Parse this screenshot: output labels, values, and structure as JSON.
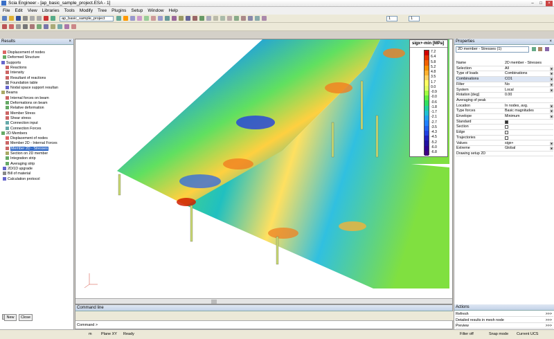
{
  "window": {
    "title": "Scia Engineer - [ap_basic_sample_project.ESA - 1]"
  },
  "menu": [
    "File",
    "Edit",
    "View",
    "Libraries",
    "Tools",
    "Modify",
    "Tree",
    "Plugins",
    "Setup",
    "Window",
    "Help"
  ],
  "toolbar": {
    "project_combo": "ap_basic_sample_project",
    "spin1": "1",
    "spin2": "1"
  },
  "results_panel": {
    "title": "Results",
    "items": [
      {
        "label": "Displacement of nodes",
        "icon": "node-icon"
      },
      {
        "label": "Deformed Structure",
        "icon": "deform-icon"
      },
      {
        "label": "Supports",
        "icon": "support-icon"
      },
      {
        "label": "Reactions",
        "icon": "reaction-icon"
      },
      {
        "label": "Intensity",
        "icon": "intensity-icon"
      },
      {
        "label": "Resultant of reactions",
        "icon": "resultant-icon"
      },
      {
        "label": "Foundation table",
        "icon": "table-icon"
      },
      {
        "label": "Nodal space support resultan",
        "icon": "support-icon"
      },
      {
        "label": "Beams",
        "icon": "beam-icon"
      },
      {
        "label": "Internal forces on beam",
        "icon": "force-icon"
      },
      {
        "label": "Deformations on beam",
        "icon": "deform-icon"
      },
      {
        "label": "Relative deformation",
        "icon": "deform-icon"
      },
      {
        "label": "Member Stress",
        "icon": "stress-icon"
      },
      {
        "label": "Shear stress",
        "icon": "stress-icon"
      },
      {
        "label": "Connection input",
        "icon": "connection-icon"
      },
      {
        "label": "Connection Forces",
        "icon": "connection-icon"
      },
      {
        "label": "2D Members",
        "icon": "member-icon"
      },
      {
        "label": "Displacement of nodes",
        "icon": "node-icon"
      },
      {
        "label": "Member 2D - Internal Forces",
        "icon": "force-icon"
      },
      {
        "label": "Member 2D - Stresses",
        "icon": "stress-icon"
      },
      {
        "label": "Section on 2D member",
        "icon": "section-icon"
      },
      {
        "label": "Integration strip",
        "icon": "strip-icon"
      },
      {
        "label": "Averaging strip",
        "icon": "strip-icon"
      },
      {
        "label": "2D/1D upgrade",
        "icon": "upgrade-icon"
      },
      {
        "label": "Bill of material",
        "icon": "table-icon"
      },
      {
        "label": "Calculation protocol",
        "icon": "protocol-icon"
      }
    ],
    "buttons": {
      "new": "New",
      "close": "Close"
    }
  },
  "legend": {
    "title": "sigx+-min [MPa]",
    "values": [
      "7.2",
      "6.4",
      "5.8",
      "5.2",
      "4.8",
      "3.5",
      "1.7",
      "0.0",
      "-0.9",
      "-0.0",
      "-0.6",
      "-1.8",
      "-1.7",
      "-2.1",
      "-2.7",
      "-3.5",
      "-4.3",
      "-4.5",
      "-5.2",
      "-6.0",
      "-6.8"
    ],
    "colors": [
      "#d00000",
      "#e83000",
      "#f06000",
      "#f89000",
      "#ffb030",
      "#ffd060",
      "#ffff60",
      "#e0ff60",
      "#a0ff40",
      "#60f040",
      "#30e060",
      "#20d0a0",
      "#20c0d0",
      "#20a0f0",
      "#2080ff",
      "#2060f0",
      "#2040e0",
      "#2020c0",
      "#2010a0",
      "#300090",
      "#400080"
    ]
  },
  "properties": {
    "title": "Properties",
    "selector": "2D member - Stresses (1)",
    "rows": [
      {
        "k": "Name",
        "v": "2D member - Stresses"
      },
      {
        "k": "Selection",
        "v": "All",
        "dd": true
      },
      {
        "k": "Type of loads",
        "v": "Combinations",
        "dd": true
      },
      {
        "k": "Combinations",
        "v": "CO1",
        "dd": true
      },
      {
        "k": "Filter",
        "v": "No",
        "dd": true
      },
      {
        "k": "System",
        "v": "Local",
        "dd": true
      },
      {
        "k": "Rotation [deg]",
        "v": "0.00"
      },
      {
        "k": "Averaging of peak",
        "v": ""
      },
      {
        "k": "Location",
        "v": "In nodes, avg.",
        "dd": true
      },
      {
        "k": "Type forces",
        "v": "Basic magnitudes",
        "dd": true
      },
      {
        "k": "Envelope",
        "v": "Minimum",
        "dd": true
      },
      {
        "k": "Standard",
        "v": "",
        "chk": true
      },
      {
        "k": "Section",
        "v": "",
        "chk": true
      },
      {
        "k": "Edge",
        "v": "",
        "chk": true
      },
      {
        "k": "Trajectories",
        "v": "",
        "chk": true
      },
      {
        "k": "Values",
        "v": "sigx+",
        "dd": true
      },
      {
        "k": "Extreme",
        "v": "Global",
        "dd": true
      },
      {
        "k": "Drawing setup 2D",
        "v": ""
      }
    ]
  },
  "actions": {
    "title": "Actions",
    "rows": [
      {
        "label": "Refresh",
        "go": ">>>"
      },
      {
        "label": "Detailed results in mesh node",
        "go": ">>>"
      },
      {
        "label": "Preview",
        "go": ">>>"
      }
    ]
  },
  "command": {
    "title": "Command line",
    "prompt": "Command >"
  },
  "status": {
    "units": "m",
    "plane": "Plane XY",
    "state": "Ready",
    "filter": "Filter off",
    "snap": "Snap mode",
    "ucs": "Current UCS"
  }
}
